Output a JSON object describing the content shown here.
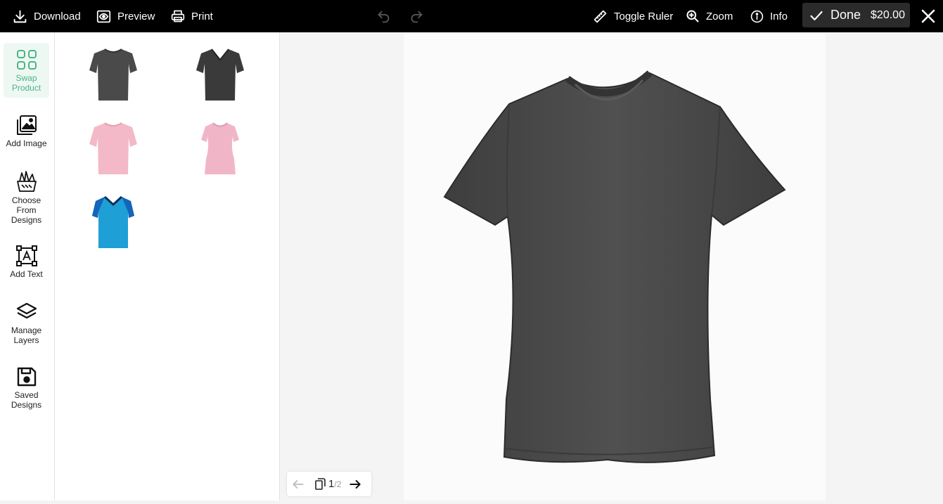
{
  "topbar": {
    "download_label": "Download",
    "preview_label": "Preview",
    "print_label": "Print",
    "ruler_label": "Toggle Ruler",
    "zoom_label": "Zoom",
    "info_label": "Info",
    "done_label": "Done",
    "price": "$20.00"
  },
  "tools": [
    {
      "label": "Swap Product",
      "icon": "grid-icon",
      "active": true
    },
    {
      "label": "Add Image",
      "icon": "image-icon"
    },
    {
      "label": "Choose From Designs",
      "icon": "designs-icon"
    },
    {
      "label": "Add Text",
      "icon": "text-icon"
    },
    {
      "label": "Manage Layers",
      "icon": "layers-icon"
    },
    {
      "label": "Saved Designs",
      "icon": "save-icon"
    }
  ],
  "products": [
    {
      "type": "crew-neck tee",
      "color": "#4a4a4a"
    },
    {
      "type": "v-neck tee",
      "color": "#3a3a3a"
    },
    {
      "type": "crew-neck tee",
      "color": "#f3b9c8"
    },
    {
      "type": "womens tee",
      "color": "#f0b6c8"
    },
    {
      "type": "jersey polo",
      "color": "#1e9fd6"
    }
  ],
  "canvas": {
    "shirt_color": "#4a4a4a",
    "bg_color": "#fbfbfb"
  },
  "pager": {
    "current": "1",
    "separator": "/",
    "total": "2"
  },
  "colors": {
    "accent": "#4bb38a",
    "topbar": "#000000"
  }
}
